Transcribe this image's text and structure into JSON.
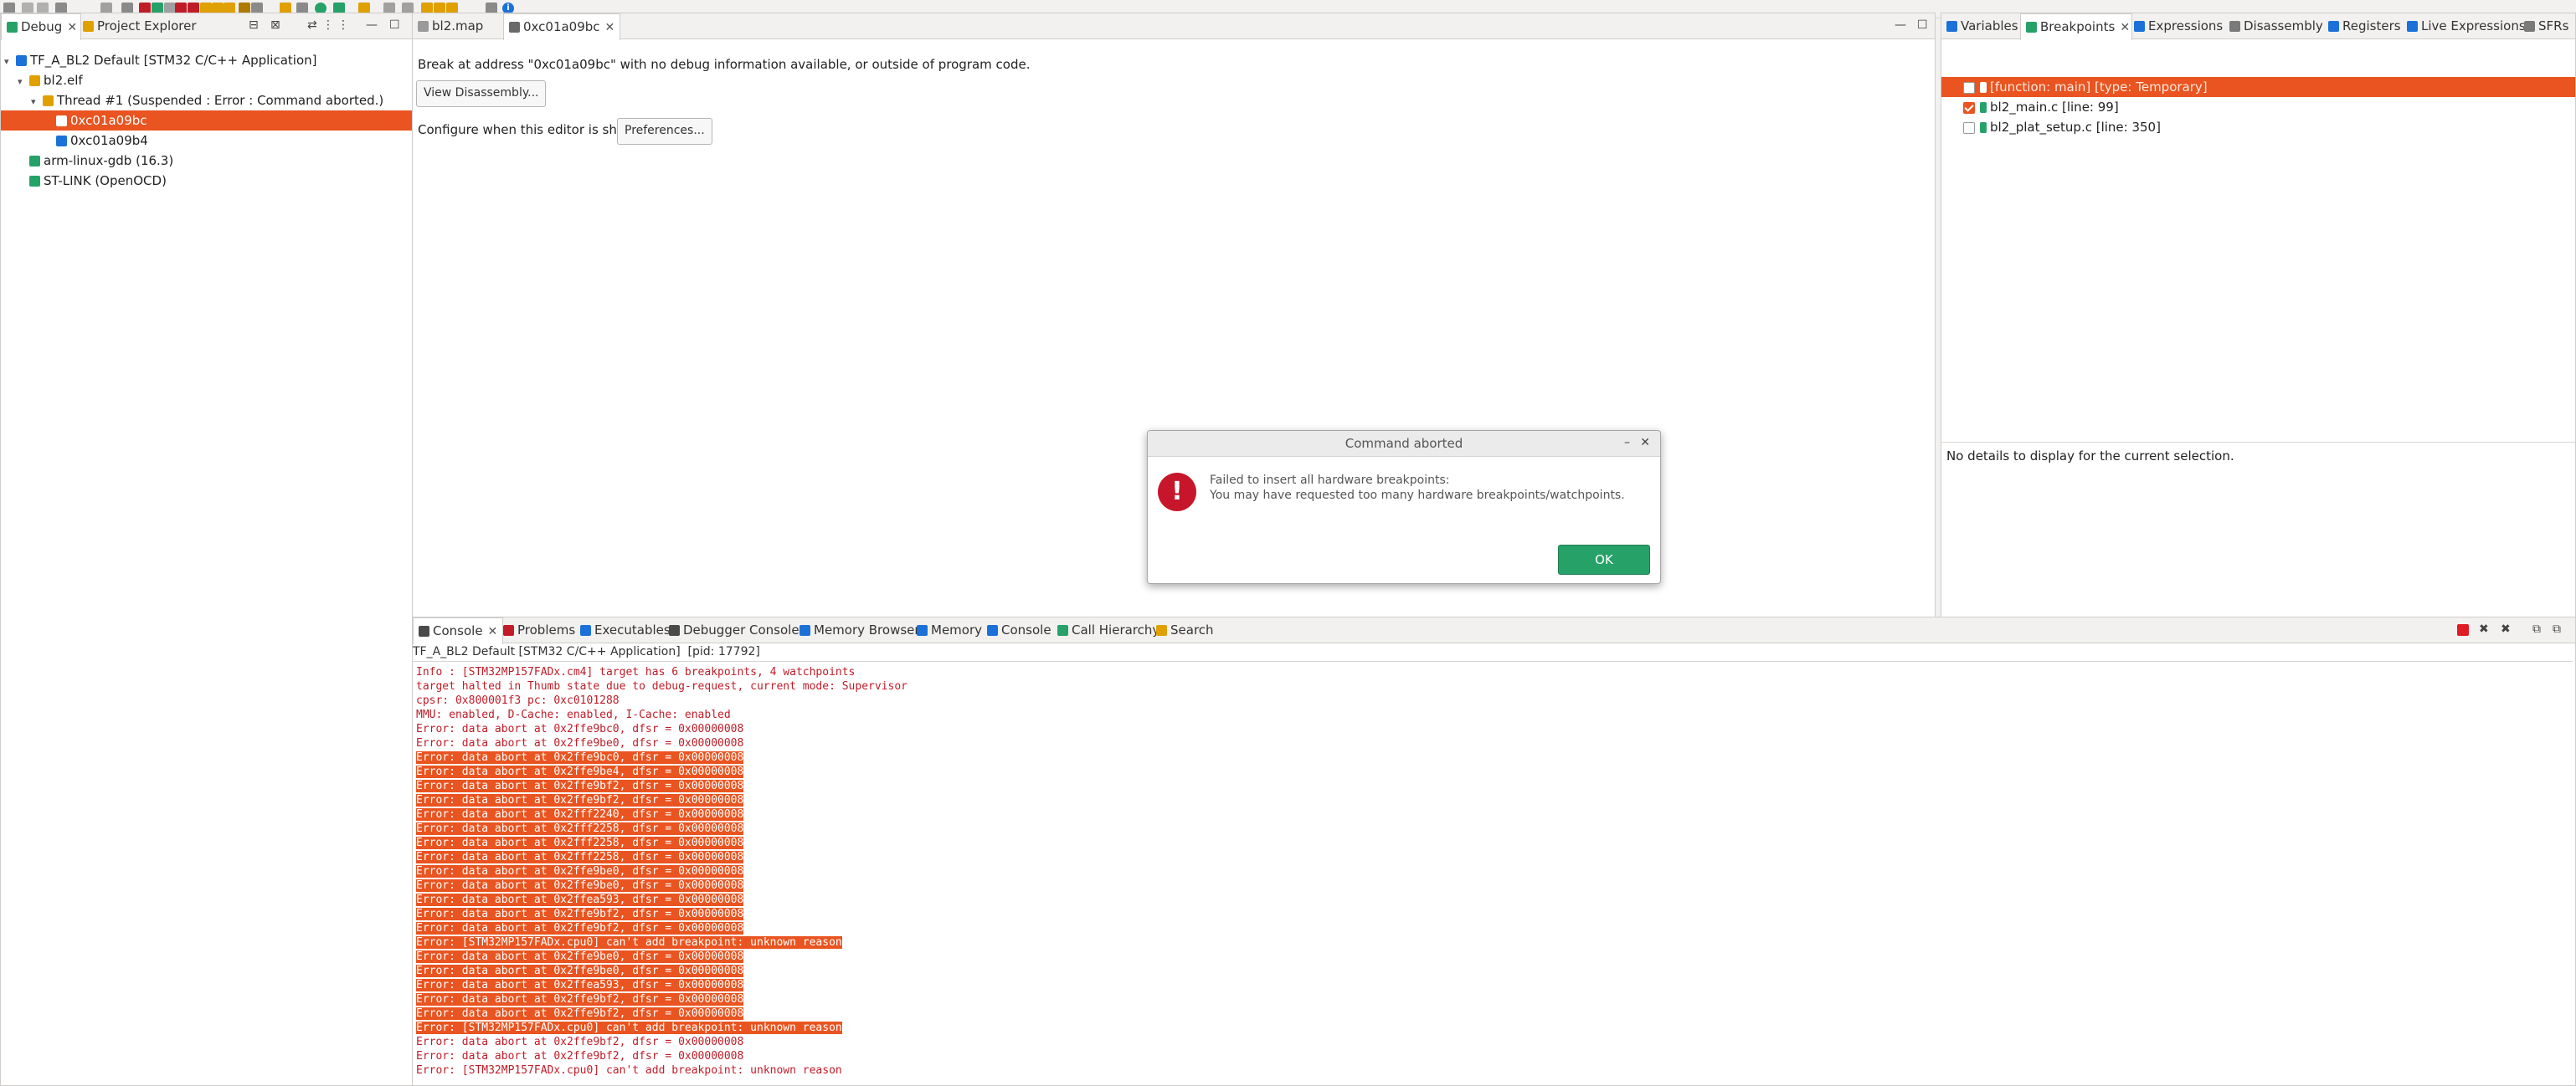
{
  "toolbar": {
    "info_icon": "info-icon"
  },
  "debug_view": {
    "tabs": [
      {
        "label": "Debug",
        "icon": "debug-icon"
      },
      {
        "label": "Project Explorer",
        "icon": "project-explorer-icon"
      }
    ],
    "tree": [
      {
        "label": "TF_A_BL2 Default [STM32 C/C++ Application]",
        "icon": "launch-config-icon",
        "indent": 0,
        "expanded": true
      },
      {
        "label": "bl2.elf",
        "icon": "process-icon",
        "indent": 1,
        "expanded": true
      },
      {
        "label": "Thread #1 (Suspended : Error : Command aborted.)",
        "icon": "thread-icon",
        "indent": 2,
        "expanded": true
      },
      {
        "label": "0xc01a09bc",
        "icon": "stack-frame-icon",
        "indent": 3,
        "selected": true
      },
      {
        "label": "0xc01a09b4",
        "icon": "stack-frame-icon",
        "indent": 3
      },
      {
        "label": "arm-linux-gdb (16.3)",
        "icon": "gdb-icon",
        "indent": 1
      },
      {
        "label": "ST-LINK (OpenOCD)",
        "icon": "gdb-server-icon",
        "indent": 1
      }
    ]
  },
  "editor": {
    "tabs": [
      {
        "label": "bl2.map",
        "icon": "file-icon"
      },
      {
        "label": "0xc01a09bc",
        "icon": "file-icon",
        "active": true
      }
    ],
    "break_message": "Break at address \"0xc01a09bc\" with no debug information available, or outside of program code.",
    "view_disassembly_label": "View Disassembly...",
    "configure_label": "Configure when this editor is shown",
    "preferences_label": "Preferences..."
  },
  "right_view": {
    "tabs": [
      {
        "label": "Variables",
        "icon": "variables-icon"
      },
      {
        "label": "Breakpoints",
        "icon": "breakpoints-icon",
        "active": true
      },
      {
        "label": "Expressions",
        "icon": "expressions-icon"
      },
      {
        "label": "Disassembly",
        "icon": "disassembly-icon"
      },
      {
        "label": "Registers",
        "icon": "registers-icon"
      },
      {
        "label": "Live Expressions",
        "icon": "live-expressions-icon"
      },
      {
        "label": "SFRs",
        "icon": "sfrs-icon"
      }
    ],
    "breakpoints": [
      {
        "label": "[function: main] [type: Temporary]",
        "checked": false,
        "selected": true
      },
      {
        "label": "bl2_main.c [line: 99]",
        "checked": true
      },
      {
        "label": "bl2_plat_setup.c [line: 350]",
        "checked": false
      }
    ],
    "details_text": "No details to display for the current selection."
  },
  "console_view": {
    "tabs": [
      {
        "label": "Console",
        "icon": "console-icon",
        "active": true
      },
      {
        "label": "Problems",
        "icon": "problems-icon"
      },
      {
        "label": "Executables",
        "icon": "executables-icon"
      },
      {
        "label": "Debugger Console",
        "icon": "debugger-console-icon"
      },
      {
        "label": "Memory Browser",
        "icon": "memory-browser-icon"
      },
      {
        "label": "Memory",
        "icon": "memory-icon"
      },
      {
        "label": "Console",
        "icon": "console-icon"
      },
      {
        "label": "Call Hierarchy",
        "icon": "call-hierarchy-icon"
      },
      {
        "label": "Search",
        "icon": "search-icon"
      }
    ],
    "title": "TF_A_BL2 Default [STM32 C/C++ Application]  [pid: 17792]",
    "lines": [
      {
        "text": "Info : [STM32MP157FADx.cm4] target has 6 breakpoints, 4 watchpoints",
        "hl": false
      },
      {
        "text": "target halted in Thumb state due to debug-request, current mode: Supervisor",
        "hl": false
      },
      {
        "text": "cpsr: 0x800001f3 pc: 0xc0101288",
        "hl": false
      },
      {
        "text": "MMU: enabled, D-Cache: enabled, I-Cache: enabled",
        "hl": false
      },
      {
        "text": "Error: data abort at 0x2ffe9bc0, dfsr = 0x00000008",
        "hl": false
      },
      {
        "text": "Error: data abort at 0x2ffe9be0, dfsr = 0x00000008",
        "hl": false
      },
      {
        "text": "Error: data abort at 0x2ffe9bc0, dfsr = 0x00000008",
        "hl": true
      },
      {
        "text": "Error: data abort at 0x2ffe9be4, dfsr = 0x00000008",
        "hl": true
      },
      {
        "text": "Error: data abort at 0x2ffe9bf2, dfsr = 0x00000008",
        "hl": true
      },
      {
        "text": "Error: data abort at 0x2ffe9bf2, dfsr = 0x00000008",
        "hl": true
      },
      {
        "text": "Error: data abort at 0x2fff2240, dfsr = 0x00000008",
        "hl": true
      },
      {
        "text": "Error: data abort at 0x2fff2258, dfsr = 0x00000008",
        "hl": true
      },
      {
        "text": "Error: data abort at 0x2fff2258, dfsr = 0x00000008",
        "hl": true
      },
      {
        "text": "Error: data abort at 0x2fff2258, dfsr = 0x00000008",
        "hl": true
      },
      {
        "text": "Error: data abort at 0x2ffe9be0, dfsr = 0x00000008",
        "hl": true
      },
      {
        "text": "Error: data abort at 0x2ffe9be0, dfsr = 0x00000008",
        "hl": true
      },
      {
        "text": "Error: data abort at 0x2ffea593, dfsr = 0x00000008",
        "hl": true
      },
      {
        "text": "Error: data abort at 0x2ffe9bf2, dfsr = 0x00000008",
        "hl": true
      },
      {
        "text": "Error: data abort at 0x2ffe9bf2, dfsr = 0x00000008",
        "hl": true
      },
      {
        "text": "Error: [STM32MP157FADx.cpu0] can't add breakpoint: unknown reason",
        "hl": true
      },
      {
        "text": "Error: data abort at 0x2ffe9be0, dfsr = 0x00000008",
        "hl": true
      },
      {
        "text": "Error: data abort at 0x2ffe9be0, dfsr = 0x00000008",
        "hl": true
      },
      {
        "text": "Error: data abort at 0x2ffea593, dfsr = 0x00000008",
        "hl": true
      },
      {
        "text": "Error: data abort at 0x2ffe9bf2, dfsr = 0x00000008",
        "hl": true
      },
      {
        "text": "Error: data abort at 0x2ffe9bf2, dfsr = 0x00000008",
        "hl": true
      },
      {
        "text": "Error: [STM32MP157FADx.cpu0] can't add breakpoint: unknown reason",
        "hl": true
      },
      {
        "text": "Error: data abort at 0x2ffe9bf2, dfsr = 0x00000008",
        "hl": false
      },
      {
        "text": "Error: data abort at 0x2ffe9bf2, dfsr = 0x00000008",
        "hl": false
      },
      {
        "text": "Error: [STM32MP157FADx.cpu0] can't add breakpoint: unknown reason",
        "hl": false
      }
    ]
  },
  "dialog": {
    "title": "Command aborted",
    "message_line1": "Failed to insert all hardware breakpoints:",
    "message_line2": "You may have requested too many hardware breakpoints/watchpoints.",
    "ok_label": "OK",
    "icon": "error-icon"
  },
  "colors": {
    "accent": "#e95420",
    "ok_button": "#26a269",
    "console_text": "#c01c28",
    "error_icon": "#c7162b"
  }
}
